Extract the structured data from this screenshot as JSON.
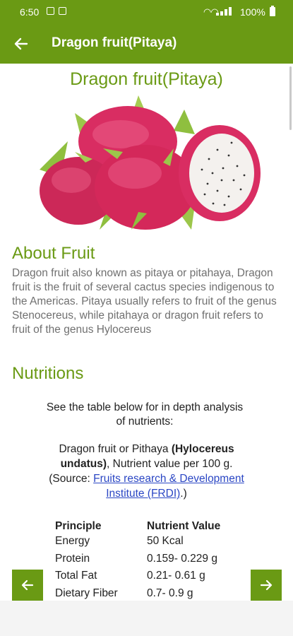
{
  "status_bar": {
    "time": "6:50",
    "battery": "100%"
  },
  "app_bar": {
    "title": "Dragon fruit(Pitaya)",
    "back_icon": "arrow-left-icon"
  },
  "page": {
    "title": "Dragon fruit(Pitaya)",
    "about_heading": "About Fruit",
    "about_text": "Dragon fruit also known as pitaya or pitahaya, Dragon fruit is the fruit of several cactus species indigenous to the Americas. Pitaya usually refers to fruit of the genus Stenocereus, while pitahaya or dragon fruit refers to fruit of the genus Hylocereus",
    "nutrition_heading": "Nutritions",
    "intro_text": "See the table below for in depth analysis of nutrients:",
    "desc_prefix": "Dragon fruit or Pithaya",
    "desc_bold": "(Hylocereus undatus)",
    "desc_middle": ", Nutrient value per 100 g.(Source: ",
    "desc_link": "Fruits research & Development Institute (FRDI)",
    "desc_suffix": ".)"
  },
  "nutrition_table": {
    "headers": [
      "Principle",
      "Nutrient Value"
    ],
    "rows": [
      [
        "Energy",
        "50 Kcal"
      ],
      [
        "Protein",
        "0.159- 0.229 g"
      ],
      [
        "Total Fat",
        "0.21- 0.61 g"
      ],
      [
        "Dietary Fiber",
        "0.7- 0.9 g"
      ]
    ]
  },
  "nav": {
    "prev_icon": "arrow-left-icon",
    "next_icon": "arrow-right-icon"
  },
  "colors": {
    "primary": "#6a9a14",
    "body_text": "#707070",
    "link": "#2a46c4"
  }
}
